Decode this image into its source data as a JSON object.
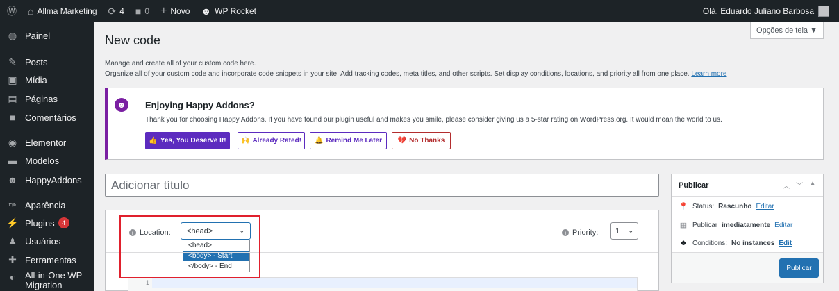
{
  "adminbar": {
    "wp_logo": "wordpress-icon",
    "site_name": "Allma Marketing",
    "updates_count": "4",
    "comments_count": "0",
    "new_label": "Novo",
    "rocket_label": "WP Rocket",
    "greeting": "Olá, Eduardo Juliano Barbosa"
  },
  "sidebar": {
    "items": [
      {
        "label": "Painel",
        "icon": "dashboard-icon"
      },
      {
        "label": "Posts",
        "icon": "pin-icon"
      },
      {
        "label": "Mídia",
        "icon": "media-icon"
      },
      {
        "label": "Páginas",
        "icon": "page-icon"
      },
      {
        "label": "Comentários",
        "icon": "comment-icon"
      },
      {
        "label": "Elementor",
        "icon": "elementor-icon"
      },
      {
        "label": "Modelos",
        "icon": "folder-icon"
      },
      {
        "label": "HappyAddons",
        "icon": "happy-icon"
      },
      {
        "label": "Aparência",
        "icon": "brush-icon"
      },
      {
        "label": "Plugins",
        "icon": "plugin-icon",
        "badge": "4"
      },
      {
        "label": "Usuários",
        "icon": "users-icon"
      },
      {
        "label": "Ferramentas",
        "icon": "wrench-icon"
      },
      {
        "label": "All-in-One WP",
        "label2": "Migration",
        "icon": "migration-icon"
      }
    ]
  },
  "screen_options": "Opções de tela ▼",
  "page": {
    "title": "New code",
    "desc1": "Manage and create all of your custom code here.",
    "desc2": "Organize all of your custom code and incorporate code snippets in your site. Add tracking codes, meta titles, and other scripts. Set display conditions, locations, and priority all from one place.",
    "learn_more": "Learn more"
  },
  "notice": {
    "title": "Enjoying Happy Addons?",
    "text": "Thank you for choosing Happy Addons. If you have found our plugin useful and makes you smile, please consider giving us a 5-star rating on WordPress.org. It would mean the world to us.",
    "btn_yes": "Yes, You Deserve It!",
    "btn_rated": "Already Rated!",
    "btn_remind": "Remind Me Later",
    "btn_no": "No Thanks"
  },
  "title_placeholder": "Adicionar título",
  "code": {
    "location_label": "Location:",
    "location_value": "<head>",
    "options": [
      "<head>",
      "<body> - Start",
      "</body> - End"
    ],
    "selected_option_index": 1,
    "priority_label": "Priority:",
    "priority_value": "1",
    "line_number": "1"
  },
  "publish": {
    "title": "Publicar",
    "status_label": "Status:",
    "status_value": "Rascunho",
    "edit": "Editar",
    "publish_label": "Publicar",
    "publish_value": "imediatamente",
    "conditions_label": "Conditions:",
    "conditions_value": "No instances",
    "conditions_edit": "Edit",
    "button": "Publicar"
  }
}
